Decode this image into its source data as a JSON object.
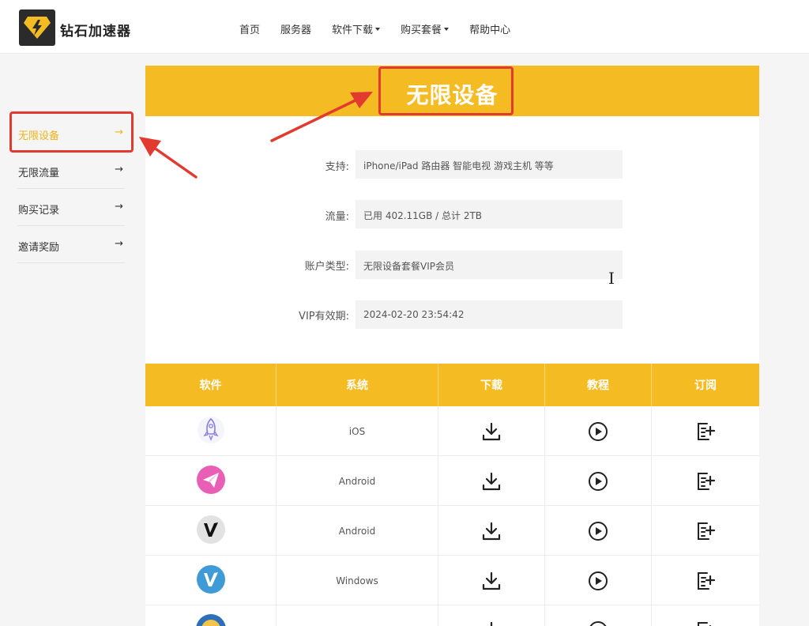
{
  "header": {
    "logo_text": "钻石加速器",
    "nav": [
      {
        "label": "首页",
        "dropdown": false
      },
      {
        "label": "服务器",
        "dropdown": false
      },
      {
        "label": "软件下载",
        "dropdown": true
      },
      {
        "label": "购买套餐",
        "dropdown": true
      },
      {
        "label": "帮助中心",
        "dropdown": false
      }
    ]
  },
  "sidebar": {
    "items": [
      {
        "label": "无限设备",
        "active": true
      },
      {
        "label": "无限流量",
        "active": false
      },
      {
        "label": "购买记录",
        "active": false
      },
      {
        "label": "邀请奖励",
        "active": false
      }
    ],
    "arrow": "→"
  },
  "main": {
    "title": "无限设备",
    "info": [
      {
        "label": "支持:",
        "value": "iPhone/iPad 路由器 智能电视 游戏主机 等等"
      },
      {
        "label": "流量:",
        "value": "已用 402.11GB / 总计 2TB"
      },
      {
        "label": "账户类型:",
        "value": "无限设备套餐VIP会员"
      },
      {
        "label": "VIP有效期:",
        "value": "2024-02-20 23:54:42"
      }
    ]
  },
  "table": {
    "headers": [
      "软件",
      "系统",
      "下载",
      "教程",
      "订阅"
    ],
    "rows": [
      {
        "app_icon": "rocket-icon",
        "system": "iOS"
      },
      {
        "app_icon": "paper-plane-icon",
        "system": "Android"
      },
      {
        "app_icon": "v-logo-dark-icon",
        "system": "Android"
      },
      {
        "app_icon": "v-logo-blue-icon",
        "system": "Windows"
      }
    ]
  },
  "colors": {
    "accent": "#f5bb22",
    "annotation": "#e23a2e"
  }
}
